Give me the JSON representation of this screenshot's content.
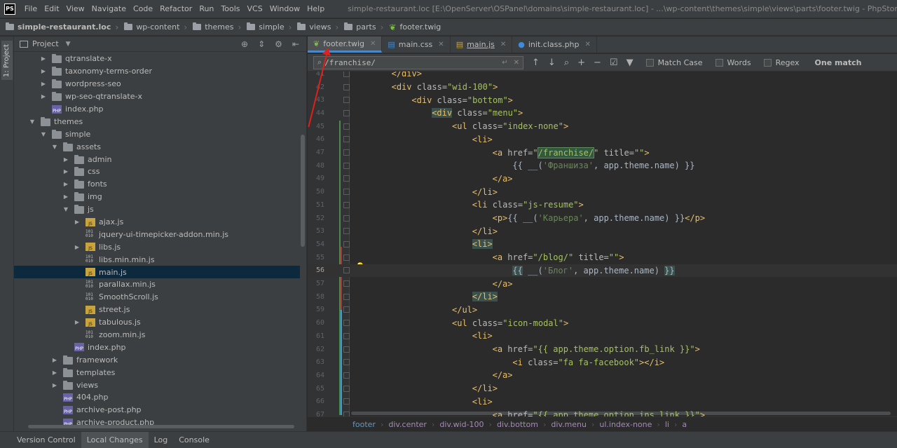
{
  "app": {
    "logo": "PS",
    "menu": [
      "File",
      "Edit",
      "View",
      "Navigate",
      "Code",
      "Refactor",
      "Run",
      "Tools",
      "VCS",
      "Window",
      "Help"
    ],
    "window_title": "simple-restaurant.loc [E:\\OpenServer\\OSPanel\\domains\\simple-restaurant.loc] - ...\\wp-content\\themes\\simple\\views\\parts\\footer.twig - PhpStorm"
  },
  "breadcrumb": [
    "simple-restaurant.loc",
    "wp-content",
    "themes",
    "simple",
    "views",
    "parts",
    "footer.twig"
  ],
  "toolstrip": {
    "project_tab": "1: Project"
  },
  "project": {
    "title": "Project",
    "tree": [
      {
        "label": "qtranslate-x",
        "type": "folder",
        "depth": 2,
        "arrow": "collapsed"
      },
      {
        "label": "taxonomy-terms-order",
        "type": "folder",
        "depth": 2,
        "arrow": "collapsed"
      },
      {
        "label": "wordpress-seo",
        "type": "folder",
        "depth": 2,
        "arrow": "collapsed"
      },
      {
        "label": "wp-seo-qtranslate-x",
        "type": "folder",
        "depth": 2,
        "arrow": "collapsed"
      },
      {
        "label": "index.php",
        "type": "php",
        "depth": 2,
        "arrow": "none"
      },
      {
        "label": "themes",
        "type": "folder",
        "depth": 1,
        "arrow": "expanded"
      },
      {
        "label": "simple",
        "type": "folder",
        "depth": 2,
        "arrow": "expanded"
      },
      {
        "label": "assets",
        "type": "folder",
        "depth": 3,
        "arrow": "expanded"
      },
      {
        "label": "admin",
        "type": "folder",
        "depth": 4,
        "arrow": "collapsed"
      },
      {
        "label": "css",
        "type": "folder",
        "depth": 4,
        "arrow": "collapsed"
      },
      {
        "label": "fonts",
        "type": "folder",
        "depth": 4,
        "arrow": "collapsed"
      },
      {
        "label": "img",
        "type": "folder",
        "depth": 4,
        "arrow": "collapsed"
      },
      {
        "label": "js",
        "type": "folder",
        "depth": 4,
        "arrow": "expanded"
      },
      {
        "label": "ajax.js",
        "type": "js",
        "depth": 5,
        "arrow": "collapsed"
      },
      {
        "label": "jquery-ui-timepicker-addon.min.js",
        "type": "bin",
        "depth": 5,
        "arrow": "none"
      },
      {
        "label": "libs.js",
        "type": "js",
        "depth": 5,
        "arrow": "collapsed"
      },
      {
        "label": "libs.min.min.js",
        "type": "bin",
        "depth": 5,
        "arrow": "none"
      },
      {
        "label": "main.js",
        "type": "js",
        "depth": 5,
        "arrow": "none",
        "selected": true
      },
      {
        "label": "parallax.min.js",
        "type": "bin",
        "depth": 5,
        "arrow": "none"
      },
      {
        "label": "SmoothScroll.js",
        "type": "bin",
        "depth": 5,
        "arrow": "none"
      },
      {
        "label": "street.js",
        "type": "js",
        "depth": 5,
        "arrow": "none"
      },
      {
        "label": "tabulous.js",
        "type": "js",
        "depth": 5,
        "arrow": "collapsed"
      },
      {
        "label": "zoom.min.js",
        "type": "bin",
        "depth": 5,
        "arrow": "none"
      },
      {
        "label": "index.php",
        "type": "php",
        "depth": 4,
        "arrow": "none"
      },
      {
        "label": "framework",
        "type": "folder",
        "depth": 3,
        "arrow": "collapsed"
      },
      {
        "label": "templates",
        "type": "folder",
        "depth": 3,
        "arrow": "collapsed"
      },
      {
        "label": "views",
        "type": "folder",
        "depth": 3,
        "arrow": "collapsed"
      },
      {
        "label": "404.php",
        "type": "php",
        "depth": 3,
        "arrow": "none"
      },
      {
        "label": "archive-post.php",
        "type": "php",
        "depth": 3,
        "arrow": "none"
      },
      {
        "label": "archive-product.php",
        "type": "php",
        "depth": 3,
        "arrow": "none"
      }
    ]
  },
  "tabs": [
    {
      "label": "footer.twig",
      "icon": "twig-icon",
      "active": true
    },
    {
      "label": "main.css",
      "icon": "css-file-icon",
      "active": false
    },
    {
      "label": "main.js",
      "icon": "js-file-icon",
      "active": false
    },
    {
      "label": "init.class.php",
      "icon": "php-class-icon",
      "active": false
    }
  ],
  "search": {
    "query": "/franchise/",
    "match_case": "Match Case",
    "words": "Words",
    "regex": "Regex",
    "result": "One match"
  },
  "editor": {
    "lines": [
      {
        "n": "41",
        "indent": 2,
        "html": "<span class=\"tag\">&lt;/div&gt;</span>"
      },
      {
        "n": "42",
        "indent": 2,
        "html": "<span class=\"tag\">&lt;div </span><span class=\"attr\">class=</span><span class=\"str\">\"wid-100\"</span><span class=\"tag\">&gt;</span>"
      },
      {
        "n": "43",
        "indent": 3,
        "html": "<span class=\"tag\">&lt;div </span><span class=\"attr\">class=</span><span class=\"str\">\"bottom\"</span><span class=\"tag\">&gt;</span>"
      },
      {
        "n": "44",
        "indent": 4,
        "html": "<span class=\"tag hl-tag\">&lt;div</span><span class=\"tag\"> </span><span class=\"attr\">class=</span><span class=\"str\">\"menu\"</span><span class=\"tag\">&gt;</span>"
      },
      {
        "n": "45",
        "indent": 5,
        "html": "<span class=\"tag\">&lt;ul </span><span class=\"attr\">class=</span><span class=\"str\">\"index-none\"</span><span class=\"tag\">&gt;</span>"
      },
      {
        "n": "46",
        "indent": 6,
        "html": "<span class=\"tag\">&lt;li&gt;</span>"
      },
      {
        "n": "47",
        "indent": 7,
        "html": "<span class=\"tag\">&lt;a </span><span class=\"attr\">href=</span><span class=\"str\">\"<span class=\"hl\">/franchise/</span>\" </span><span class=\"attr\">title=</span><span class=\"str\">\"\"</span><span class=\"tag\">&gt;</span>"
      },
      {
        "n": "48",
        "indent": 8,
        "html": "<span class=\"twg\">{{ __(</span><span class=\"tstr\">'Франшиза'</span><span class=\"twg\">, app.theme.name) }}</span>"
      },
      {
        "n": "49",
        "indent": 7,
        "html": "<span class=\"tag\">&lt;/a&gt;</span>"
      },
      {
        "n": "50",
        "indent": 6,
        "html": "<span class=\"tag\">&lt;/li&gt;</span>"
      },
      {
        "n": "51",
        "indent": 6,
        "html": "<span class=\"tag\">&lt;li </span><span class=\"attr\">class=</span><span class=\"str\">\"js-resume\"</span><span class=\"tag\">&gt;</span>"
      },
      {
        "n": "52",
        "indent": 7,
        "html": "<span class=\"tag\">&lt;p&gt;</span><span class=\"twg\">{{ __(</span><span class=\"tstr\">'Карьера'</span><span class=\"twg\">, app.theme.name) }}</span><span class=\"tag\">&lt;/p&gt;</span>"
      },
      {
        "n": "53",
        "indent": 6,
        "html": "<span class=\"tag\">&lt;/li&gt;</span>"
      },
      {
        "n": "54",
        "indent": 6,
        "html": "<span class=\"tag hl-tag\">&lt;li&gt;</span>"
      },
      {
        "n": "55",
        "indent": 7,
        "html": "<span class=\"tag\">&lt;a </span><span class=\"attr\">href=</span><span class=\"str\">\"/blog/\" </span><span class=\"attr\">title=</span><span class=\"str\">\"\"</span><span class=\"tag\">&gt;</span>"
      },
      {
        "n": "56",
        "indent": 8,
        "current": true,
        "html": "<span class=\"twg hl-tag\">{{</span><span class=\"twg\"> __(</span><span class=\"tstr\">'Блог'</span><span class=\"twg\">, app.theme.name) </span><span class=\"twg hl-tag\">}}</span>"
      },
      {
        "n": "57",
        "indent": 7,
        "html": "<span class=\"tag\">&lt;/a&gt;</span>"
      },
      {
        "n": "58",
        "indent": 6,
        "html": "<span class=\"tag hl-tag\">&lt;/li&gt;</span>"
      },
      {
        "n": "59",
        "indent": 5,
        "html": "<span class=\"tag\">&lt;/ul&gt;</span>"
      },
      {
        "n": "60",
        "indent": 5,
        "html": "<span class=\"tag\">&lt;ul </span><span class=\"attr\">class=</span><span class=\"str\">\"icon-modal\"</span><span class=\"tag\">&gt;</span>"
      },
      {
        "n": "61",
        "indent": 6,
        "html": "<span class=\"tag\">&lt;li&gt;</span>"
      },
      {
        "n": "62",
        "indent": 7,
        "html": "<span class=\"tag\">&lt;a </span><span class=\"attr\">href=</span><span class=\"str\">\"{{ app.theme.option.fb_link }}\"</span><span class=\"tag\">&gt;</span>"
      },
      {
        "n": "63",
        "indent": 8,
        "html": "<span class=\"tag\">&lt;i </span><span class=\"attr\">class=</span><span class=\"str\">\"fa fa-facebook\"</span><span class=\"tag\">&gt;&lt;/i&gt;</span>"
      },
      {
        "n": "64",
        "indent": 7,
        "html": "<span class=\"tag\">&lt;/a&gt;</span>"
      },
      {
        "n": "65",
        "indent": 6,
        "html": "<span class=\"tag\">&lt;/li&gt;</span>"
      },
      {
        "n": "66",
        "indent": 6,
        "html": "<span class=\"tag\">&lt;li&gt;</span>"
      },
      {
        "n": "67",
        "indent": 7,
        "html": "<span class=\"tag\">&lt;a </span><span class=\"attr\">href=</span><span class=\"str\">\"{{ app.theme.option.ins_link }}\"</span><span class=\"tag\">&gt;</span>"
      }
    ]
  },
  "editor_breadcrumb": [
    "footer",
    "div.center",
    "div.wid-100",
    "div.bottom",
    "div.menu",
    "ul.index-none",
    "li",
    "a"
  ],
  "bottom_tabs": [
    {
      "label": "Version Control",
      "active": false
    },
    {
      "label": "Local Changes",
      "active": true
    },
    {
      "label": "Log",
      "active": false
    },
    {
      "label": "Console",
      "active": false
    }
  ]
}
